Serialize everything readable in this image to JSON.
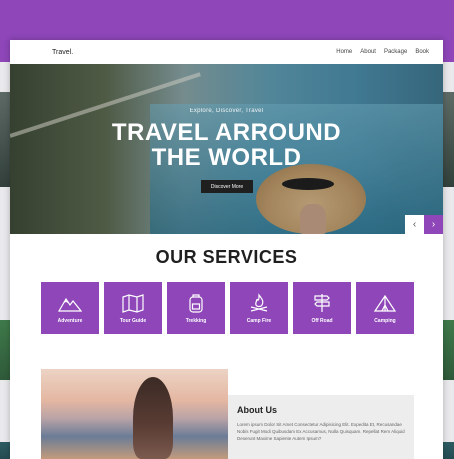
{
  "nav": {
    "brand": "Travel.",
    "links": [
      "Home",
      "About",
      "Package",
      "Book"
    ]
  },
  "hero": {
    "subtitle": "Explore, Discover, Travel",
    "title_line1": "TRAVEL ARROUND",
    "title_line2": "THE WORLD",
    "button": "Discover More",
    "prev_arrow": "‹",
    "next_arrow": "›"
  },
  "services": {
    "title": "OUR SERVICES",
    "items": [
      {
        "label": "Adventure",
        "icon": "mountain-icon"
      },
      {
        "label": "Tour Guide",
        "icon": "map-icon"
      },
      {
        "label": "Trekking",
        "icon": "backpack-icon"
      },
      {
        "label": "Camp Fire",
        "icon": "campfire-icon"
      },
      {
        "label": "Off Road",
        "icon": "signpost-icon"
      },
      {
        "label": "Camping",
        "icon": "tent-icon"
      }
    ]
  },
  "about": {
    "title": "About Us",
    "text": "Lorem ipsum Dolor Sit Amet Consectetur Adipisicing Elit. Expedita Et, Recusandae Nobis Fugit Modi Quibusdam Ex Accusamus, Nulla Quisquam. Repellat Rem Aliquid Deserunt Maxime Sapiente Autem Ipsum?"
  },
  "colors": {
    "accent": "#8e46b8",
    "button_dark": "#1f1f1f"
  }
}
